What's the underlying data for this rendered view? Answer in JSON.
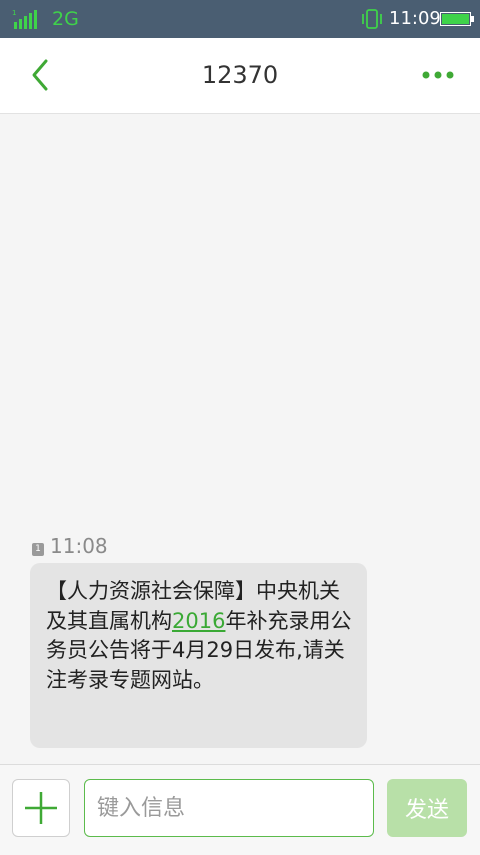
{
  "status_bar": {
    "network": "2G",
    "time": "11:09",
    "signal_icon": "signal-bars-icon",
    "vibrate_icon": "vibrate-icon",
    "battery_icon": "battery-icon"
  },
  "header": {
    "title": "12370",
    "back_icon": "chevron-left-icon",
    "more_icon": "more-dots-icon"
  },
  "conversation": {
    "messages": [
      {
        "sim": "1",
        "time": "11:08",
        "text_before": "【人力资源社会保障】中央机关及其直属机构",
        "link_text": "2016",
        "text_after": "年补充录用公务员公告将于4月29日发布,请关注考录专题网站。"
      }
    ]
  },
  "composer": {
    "add_icon": "plus-icon",
    "placeholder": "键入信息",
    "send_label": "发送"
  },
  "colors": {
    "accent": "#3fa935",
    "status_bar_bg": "#4a5e72",
    "bubble_bg": "#e4e4e4",
    "send_disabled": "#b8e0a8"
  }
}
